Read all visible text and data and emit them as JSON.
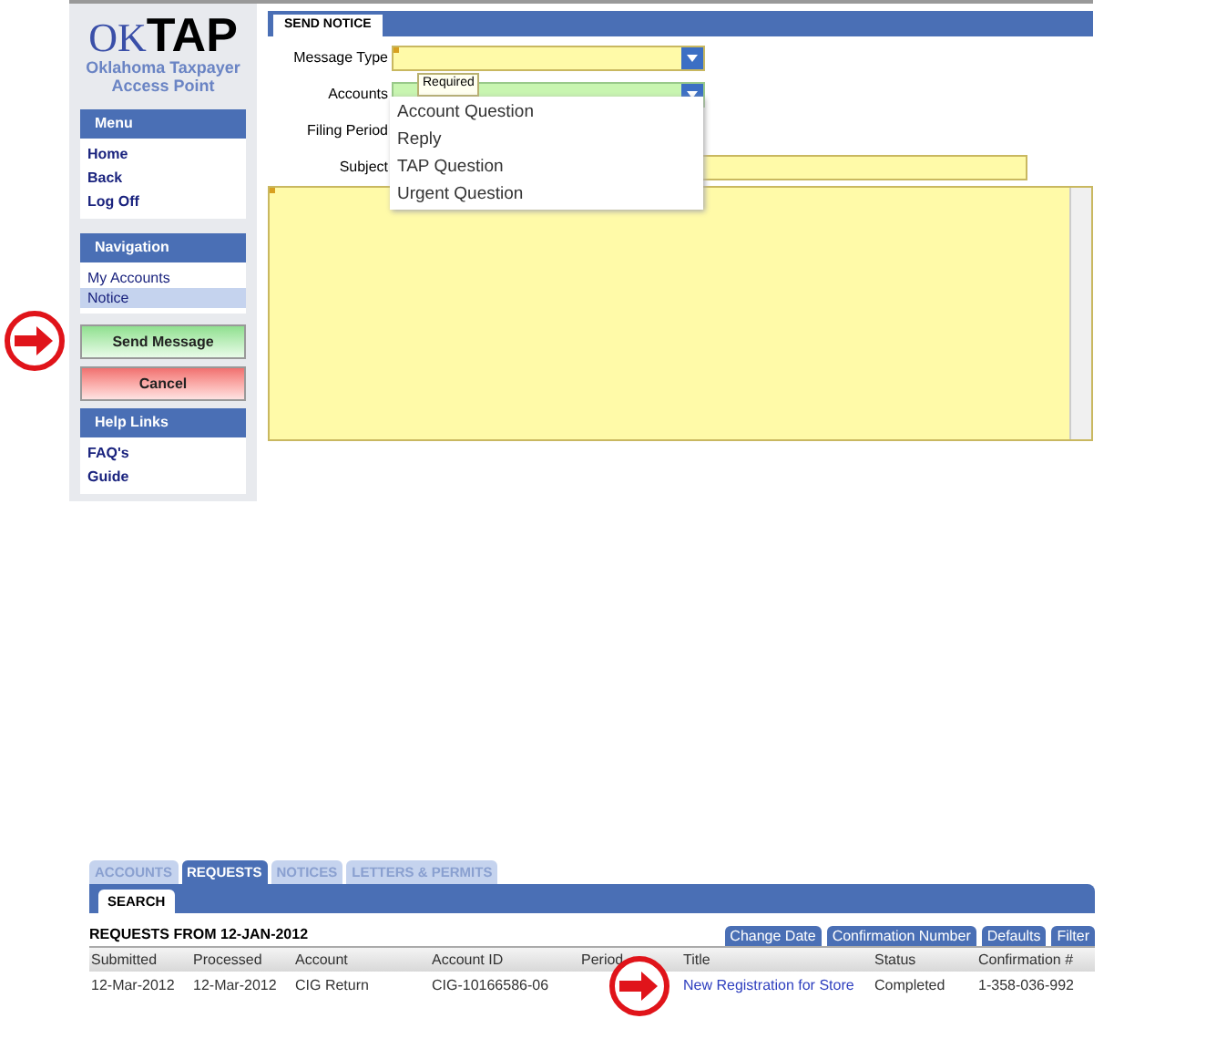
{
  "logo": {
    "initials": "OK",
    "brand": "TAP",
    "subtitle": "Oklahoma Taxpayer Access Point"
  },
  "menu": {
    "title": "Menu",
    "items": [
      "Home",
      "Back",
      "Log Off"
    ]
  },
  "navigation": {
    "title": "Navigation",
    "items": [
      {
        "label": "My Accounts",
        "selected": false
      },
      {
        "label": "Notice",
        "selected": true
      }
    ]
  },
  "actions": [
    {
      "label": "Send Message",
      "kind": "send",
      "highlighted": true
    },
    {
      "label": "Cancel",
      "kind": "cancel",
      "highlighted": false
    }
  ],
  "help": {
    "title": "Help Links",
    "items": [
      "FAQ's",
      "Guide"
    ]
  },
  "form": {
    "tab": "SEND NOTICE",
    "fields": [
      {
        "label": "Message Type",
        "kind": "combo",
        "required": true
      },
      {
        "label": "Accounts",
        "kind": "combo",
        "required": false
      },
      {
        "label": "Filing Period",
        "kind": "hidden",
        "required": false
      },
      {
        "label": "Subject",
        "kind": "text",
        "required": false
      }
    ],
    "tooltip": "Required",
    "options": [
      "Account Question",
      "Reply",
      "TAP Question",
      "Urgent Question"
    ]
  },
  "requests": {
    "tabs": [
      {
        "label": "ACCOUNTS",
        "selected": false
      },
      {
        "label": "REQUESTS",
        "selected": true
      },
      {
        "label": "NOTICES",
        "selected": false
      },
      {
        "label": "LETTERS & PERMITS",
        "selected": false
      }
    ],
    "subtab": "SEARCH",
    "heading": "REQUESTS FROM 12-JAN-2012",
    "buttons": [
      "Change Date",
      "Confirmation Number",
      "Defaults",
      "Filter"
    ],
    "columns": [
      "Submitted",
      "Processed",
      "Account",
      "Account ID",
      "Period",
      "Title",
      "Status",
      "Confirmation #"
    ],
    "rows": [
      {
        "cells": [
          "12-Mar-2012",
          "12-Mar-2012",
          "CIG Return",
          "CIG-10166586-06",
          "",
          "New Registration for Store",
          "Completed",
          "1-358-036-992"
        ],
        "highlighted": true
      }
    ]
  }
}
